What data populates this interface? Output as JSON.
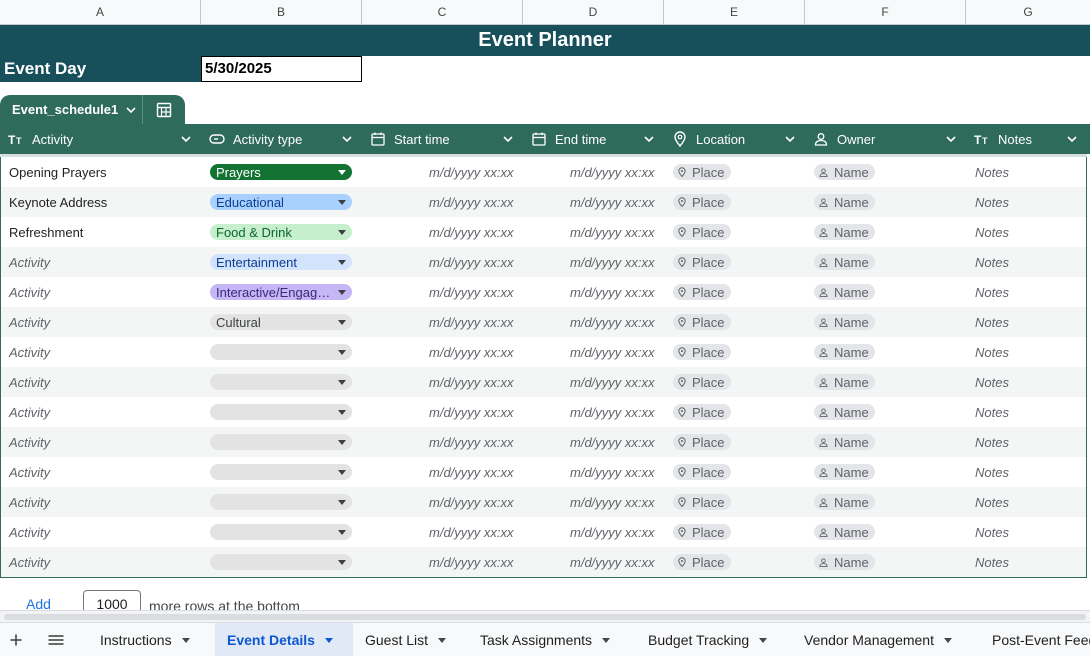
{
  "column_letters": [
    "A",
    "B",
    "C",
    "D",
    "E",
    "F",
    "G"
  ],
  "title": "Event Planner",
  "event_day": {
    "label": "Event Day",
    "value": "5/30/2025"
  },
  "table": {
    "name": "Event_schedule1",
    "columns": [
      {
        "label": "Activity",
        "icon": "text-type-icon"
      },
      {
        "label": "Activity type",
        "icon": "dropdown-chip-icon"
      },
      {
        "label": "Start time",
        "icon": "calendar-icon"
      },
      {
        "label": "End time",
        "icon": "calendar-icon"
      },
      {
        "label": "Location",
        "icon": "location-pin-icon"
      },
      {
        "label": "Owner",
        "icon": "person-icon"
      },
      {
        "label": "Notes",
        "icon": "text-type-icon"
      }
    ],
    "rows": [
      {
        "activity": "Opening Prayers",
        "activity_placeholder": false,
        "type": "Prayers",
        "type_bg": "#137333",
        "type_fg": "#ffffff"
      },
      {
        "activity": "Keynote Address",
        "activity_placeholder": false,
        "type": "Educational",
        "type_bg": "#a8d1ff",
        "type_fg": "#0b3d91"
      },
      {
        "activity": "Refreshment",
        "activity_placeholder": false,
        "type": "Food & Drink",
        "type_bg": "#c6efce",
        "type_fg": "#0d652d"
      },
      {
        "activity": "Activity",
        "activity_placeholder": true,
        "type": "Entertainment",
        "type_bg": "#d3e3fd",
        "type_fg": "#0b3d91"
      },
      {
        "activity": "Activity",
        "activity_placeholder": true,
        "type": "Interactive/Engagement",
        "type_bg": "#c5b6f6",
        "type_fg": "#3b2a7a"
      },
      {
        "activity": "Activity",
        "activity_placeholder": true,
        "type": "Cultural",
        "type_bg": "#e3e3e3",
        "type_fg": "#3c4043"
      },
      {
        "activity": "Activity",
        "activity_placeholder": true,
        "type": "",
        "type_bg": "#e3e3e3",
        "type_fg": "#3c4043"
      },
      {
        "activity": "Activity",
        "activity_placeholder": true,
        "type": "",
        "type_bg": "#e3e3e3",
        "type_fg": "#3c4043"
      },
      {
        "activity": "Activity",
        "activity_placeholder": true,
        "type": "",
        "type_bg": "#e3e3e3",
        "type_fg": "#3c4043"
      },
      {
        "activity": "Activity",
        "activity_placeholder": true,
        "type": "",
        "type_bg": "#e3e3e3",
        "type_fg": "#3c4043"
      },
      {
        "activity": "Activity",
        "activity_placeholder": true,
        "type": "",
        "type_bg": "#e3e3e3",
        "type_fg": "#3c4043"
      },
      {
        "activity": "Activity",
        "activity_placeholder": true,
        "type": "",
        "type_bg": "#e3e3e3",
        "type_fg": "#3c4043"
      },
      {
        "activity": "Activity",
        "activity_placeholder": true,
        "type": "",
        "type_bg": "#e3e3e3",
        "type_fg": "#3c4043"
      },
      {
        "activity": "Activity",
        "activity_placeholder": true,
        "type": "",
        "type_bg": "#e3e3e3",
        "type_fg": "#3c4043"
      }
    ],
    "placeholders": {
      "start_time": "m/d/yyyy xx:xx",
      "end_time": "m/d/yyyy xx:xx",
      "location": "Place",
      "owner": "Name",
      "notes": "Notes"
    }
  },
  "add_rows": {
    "link": "Add",
    "count": "1000",
    "text": "more rows at the bottom"
  },
  "sheet_tabs": [
    {
      "label": "Instructions",
      "active": false
    },
    {
      "label": "Event Details",
      "active": true
    },
    {
      "label": "Guest List",
      "active": false
    },
    {
      "label": "Task Assignments",
      "active": false
    },
    {
      "label": "Budget Tracking",
      "active": false
    },
    {
      "label": "Vendor Management",
      "active": false
    },
    {
      "label": "Post-Event Feedback",
      "active": false
    }
  ],
  "colors": {
    "header_teal": "#174f5b",
    "table_green": "#2f6b5a",
    "active_tab": "#0b57d0"
  }
}
